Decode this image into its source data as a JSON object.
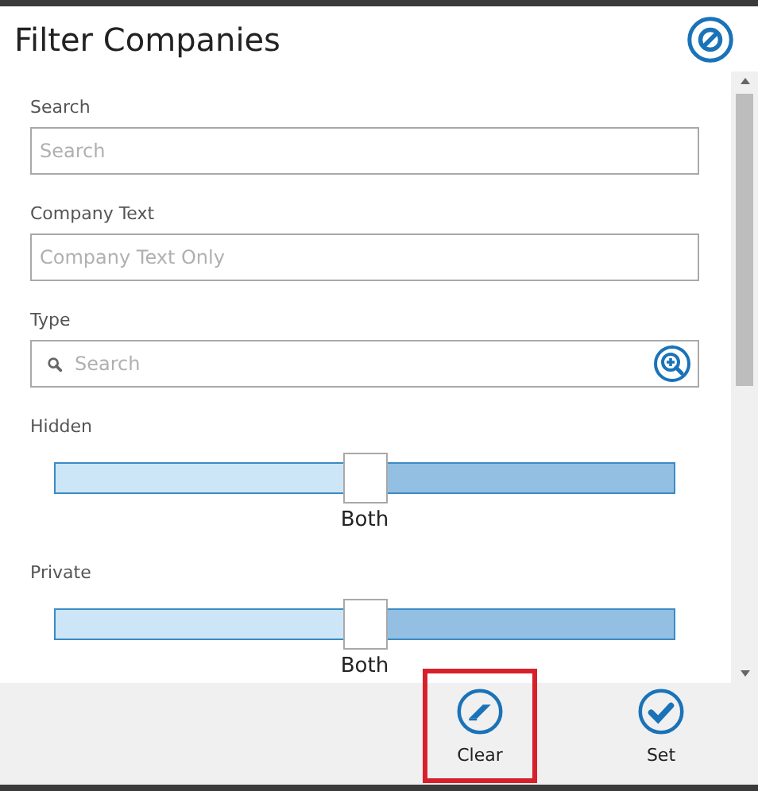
{
  "dialog": {
    "title": "Filter Companies"
  },
  "fields": [
    {
      "kind": "text",
      "label": "Search",
      "placeholder": "Search"
    },
    {
      "kind": "text",
      "label": "Company Text",
      "placeholder": "Company Text Only"
    },
    {
      "kind": "lookup",
      "label": "Type",
      "placeholder": "Search"
    },
    {
      "kind": "slider",
      "label": "Hidden",
      "level": 0.5,
      "reading": "Both"
    },
    {
      "kind": "slider",
      "label": "Private",
      "level": 0.5,
      "reading": "Both"
    }
  ],
  "buttons": [
    {
      "kind": "clear",
      "label": "Clear",
      "highlighted": true
    },
    {
      "kind": "set",
      "label": "Set",
      "highlighted": false
    }
  ]
}
